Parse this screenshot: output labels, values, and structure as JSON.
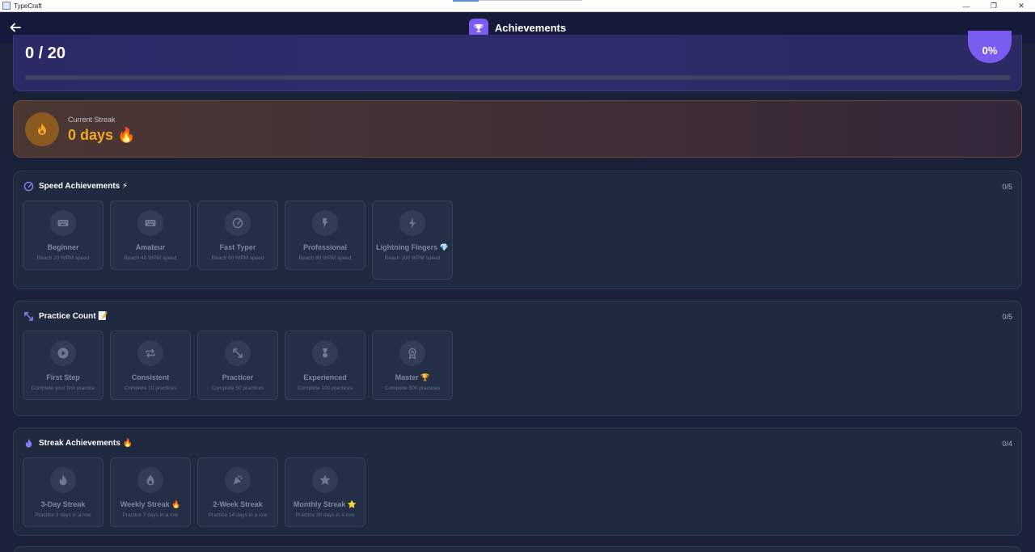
{
  "window": {
    "title": "TypeCraft",
    "controls": [
      "—",
      "❐",
      "✕"
    ]
  },
  "header": {
    "title": "Achievements",
    "back_icon": "arrow-left-icon",
    "title_icon": "trophy-icon"
  },
  "summary": {
    "count": "0 / 20",
    "percent": "0%",
    "progress": 0
  },
  "streak": {
    "label": "Current Streak",
    "value": "0 days 🔥"
  },
  "sections": [
    {
      "title": "Speed Achievements ⚡",
      "count": "0/5",
      "icon": "speedometer-icon",
      "badges": [
        {
          "name": "Beginner",
          "desc": "Reach 20 WPM speed",
          "icon": "keyboard-icon"
        },
        {
          "name": "Amateur",
          "desc": "Reach 40 WPM speed",
          "icon": "keyboard-icon"
        },
        {
          "name": "Fast Typer",
          "desc": "Reach 60 WPM speed",
          "icon": "speedometer-icon"
        },
        {
          "name": "Professional",
          "desc": "Reach 80 WPM speed",
          "icon": "lightning-icon"
        },
        {
          "name": "Lightning Fingers 💎",
          "desc": "Reach 100 WPM speed",
          "icon": "bolt-icon"
        }
      ]
    },
    {
      "title": "Practice Count 📝",
      "count": "0/5",
      "icon": "expand-arrows-icon",
      "badges": [
        {
          "name": "First Step",
          "desc": "Complete your first practice",
          "icon": "play-icon"
        },
        {
          "name": "Consistent",
          "desc": "Complete 10 practices",
          "icon": "repeat-icon"
        },
        {
          "name": "Practicer",
          "desc": "Complete 50 practices",
          "icon": "expand-arrows-icon"
        },
        {
          "name": "Experienced",
          "desc": "Complete 100 practices",
          "icon": "medal-icon"
        },
        {
          "name": "Master 🏆",
          "desc": "Complete 500 practices",
          "icon": "award-icon"
        }
      ]
    },
    {
      "title": "Streak Achievements 🔥",
      "count": "0/4",
      "icon": "flame-icon",
      "badges": [
        {
          "name": "3-Day Streak",
          "desc": "Practice 3 days in a row",
          "icon": "flame-icon"
        },
        {
          "name": "Weekly Streak 🔥",
          "desc": "Practice 7 days in a row",
          "icon": "fire-icon"
        },
        {
          "name": "2-Week Streak",
          "desc": "Practice 14 days in a row",
          "icon": "party-icon"
        },
        {
          "name": "Monthly Streak ⭐",
          "desc": "Practice 30 days in a row",
          "icon": "star-icon"
        }
      ]
    }
  ],
  "colors": {
    "accent": "#7b5cf0",
    "streak": "#f5a623",
    "background": "#1a2037",
    "card": "#1f2a3f"
  }
}
